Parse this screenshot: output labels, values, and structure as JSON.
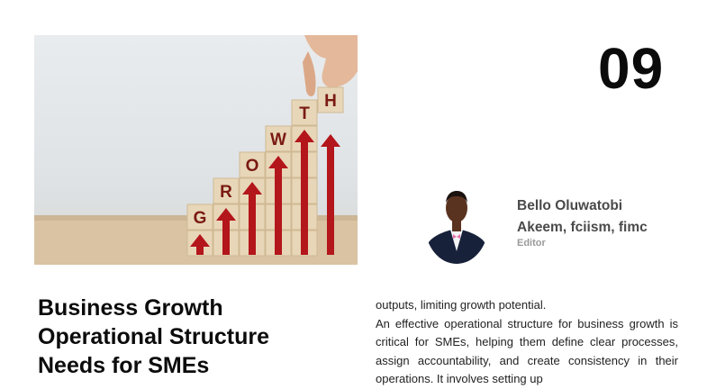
{
  "page": {
    "number": "09"
  },
  "hero": {
    "blocks": [
      {
        "letter": "G"
      },
      {
        "letter": "R"
      },
      {
        "letter": "O"
      },
      {
        "letter": "W"
      },
      {
        "letter": "T"
      },
      {
        "letter": "H"
      }
    ],
    "colors": {
      "block": "#e8d6b8",
      "arrow": "#b3161b",
      "letter": "#7a1a12"
    }
  },
  "author": {
    "name_line1": "Bello Oluwatobi",
    "name_line2": "Akeem, fciism, fimc",
    "role": "Editor"
  },
  "article": {
    "headline": "Business Growth Operational Structure Needs for SMEs",
    "paragraphs": [
      "outputs, limiting growth potential.",
      "An effective operational structure for business growth is critical for SMEs, helping them define clear processes, assign accountability, and create consistency in their operations. It involves setting up"
    ]
  }
}
